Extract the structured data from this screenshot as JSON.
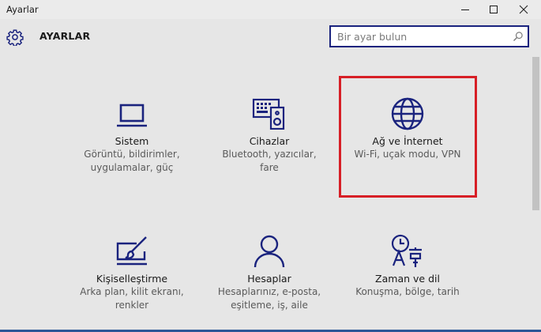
{
  "window": {
    "title": "Ayarlar"
  },
  "header": {
    "title": "AYARLAR",
    "gear_icon": "gear-icon"
  },
  "search": {
    "placeholder": "Bir ayar bulun",
    "icon": "search-icon"
  },
  "tiles": [
    {
      "icon": "laptop-icon",
      "title": "Sistem",
      "desc1": "Görüntü, bildirimler,",
      "desc2": "uygulamalar, güç"
    },
    {
      "icon": "keyboard-speaker-icon",
      "title": "Cihazlar",
      "desc1": "Bluetooth, yazıcılar, fare",
      "desc2": ""
    },
    {
      "icon": "globe-icon",
      "title": "Ağ ve İnternet",
      "desc1": "Wi-Fi, uçak modu, VPN",
      "desc2": ""
    },
    {
      "icon": "paint-brush-icon",
      "title": "Kişiselleştirme",
      "desc1": "Arka plan, kilit ekranı,",
      "desc2": "renkler"
    },
    {
      "icon": "person-icon",
      "title": "Hesaplar",
      "desc1": "Hesaplarınız, e-posta,",
      "desc2": "eşitleme, iş, aile"
    },
    {
      "icon": "time-language-icon",
      "title": "Zaman ve dil",
      "desc1": "Konuşma, bölge, tarih",
      "desc2": ""
    }
  ],
  "colors": {
    "accent": "#1a237e",
    "highlight": "#d71f26",
    "background": "#e6e6e6"
  }
}
